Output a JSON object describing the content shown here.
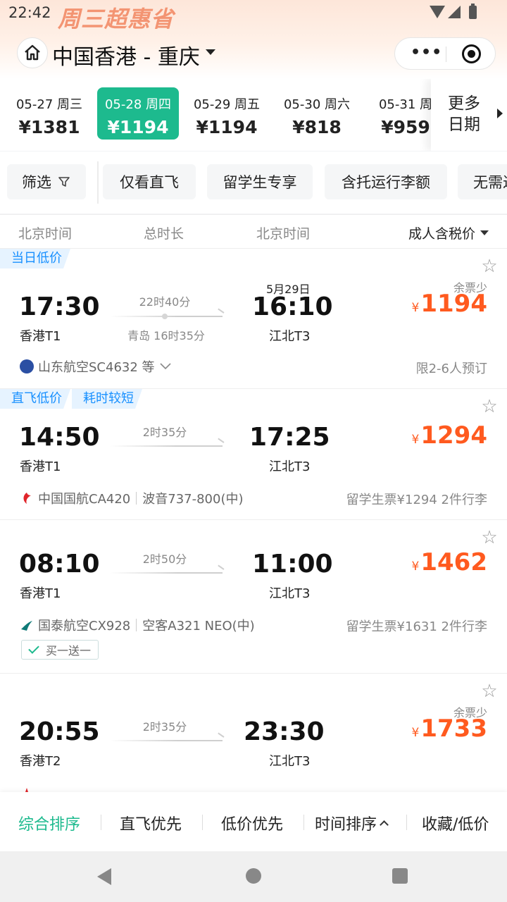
{
  "status": {
    "time": "22:42",
    "promo_banner": "周三超惠省"
  },
  "title": {
    "route": "中国香港 - 重庆"
  },
  "dates": [
    {
      "date": "05-27",
      "weekday": "周三",
      "price": "¥1381",
      "active": false
    },
    {
      "date": "05-28",
      "weekday": "周四",
      "price": "¥1194",
      "active": true
    },
    {
      "date": "05-29",
      "weekday": "周五",
      "price": "¥1194",
      "active": false
    },
    {
      "date": "05-30",
      "weekday": "周六",
      "price": "¥818",
      "active": false
    },
    {
      "date": "05-31",
      "weekday": "周",
      "price": "¥959",
      "active": false
    }
  ],
  "more_dates": {
    "line1": "更多",
    "line2": "日期"
  },
  "filters": {
    "filter": "筛选",
    "direct_only": "仅看直飞",
    "student": "留学生专享",
    "baggage": "含托运行李额",
    "no_visa": "无需过"
  },
  "column_header": {
    "dep_tz": "北京时间",
    "duration": "总时长",
    "arr_tz": "北京时间",
    "sort": "成人含税价"
  },
  "flights": [
    {
      "tags": [
        "当日低价"
      ],
      "dep_time": "17:30",
      "dep_airport": "香港T1",
      "duration": "22时40分",
      "stop": "青岛 16时35分",
      "arr_date": "5月29日",
      "arr_time": "16:10",
      "arr_airport": "江北T3",
      "seats_note": "余票少",
      "currency": "¥",
      "price": "1194",
      "airline": "山东航空SC4632 等",
      "aircraft": "",
      "right_note": "限2-6人预订",
      "promo": "",
      "brand_color": "#2b4fa3"
    },
    {
      "tags": [
        "直飞低价",
        "耗时较短"
      ],
      "dep_time": "14:50",
      "dep_airport": "香港T1",
      "duration": "2时35分",
      "stop": "",
      "arr_date": "",
      "arr_time": "17:25",
      "arr_airport": "江北T3",
      "seats_note": "",
      "currency": "¥",
      "price": "1294",
      "airline": "中国国航CA420",
      "aircraft": "波音737-800(中)",
      "right_note": "留学生票¥1294 2件行李",
      "promo": "",
      "brand_color": "#e0242a"
    },
    {
      "tags": [],
      "dep_time": "08:10",
      "dep_airport": "香港T1",
      "duration": "2时50分",
      "stop": "",
      "arr_date": "",
      "arr_time": "11:00",
      "arr_airport": "江北T3",
      "seats_note": "",
      "currency": "¥",
      "price": "1462",
      "airline": "国泰航空CX928",
      "aircraft": "空客A321 NEO(中)",
      "right_note": "留学生票¥1631 2件行李",
      "promo": "买一送一",
      "brand_color": "#0f7a77"
    },
    {
      "tags": [],
      "dep_time": "20:55",
      "dep_airport": "香港T2",
      "duration": "2时35分",
      "stop": "",
      "arr_date": "",
      "arr_time": "23:30",
      "arr_airport": "江北T3",
      "seats_note": "余票少",
      "currency": "¥",
      "price": "1733",
      "airline": "",
      "aircraft": "",
      "right_note": "",
      "promo": "",
      "brand_color": "#e0242a"
    }
  ],
  "bottom_sort": {
    "overall": "综合排序",
    "direct": "直飞优先",
    "low_price": "低价优先",
    "time": "时间排序",
    "favorites": "收藏/低价"
  },
  "colors": {
    "accent": "#1dba8e",
    "price": "#ff5a1f",
    "tag_blue": "#1890ff"
  }
}
